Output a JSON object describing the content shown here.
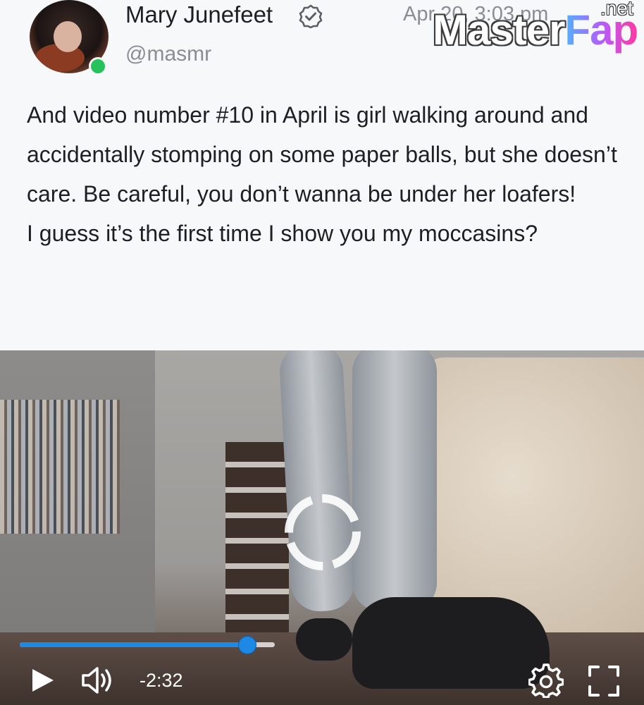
{
  "author": {
    "display_name": "Mary Junefeet",
    "handle": "@masmr",
    "verified": true,
    "online": true,
    "status_color": "#27c25b"
  },
  "post": {
    "timestamp": "Apr 20, 3:03 pm",
    "text_lines": [
      "And video number #10 in April is girl walking around and accidentally stomping on some paper balls, but she doesn’t care. Be careful, you don’t wanna be under her loafers!",
      "I guess it’s the first time I show you my moccasins?"
    ]
  },
  "watermark": {
    "main_left": "Master",
    "main_right": "Fap",
    "tld": ".net"
  },
  "video": {
    "state": "loading",
    "progress_fraction": 0.89,
    "time_remaining": "-2:32",
    "accent_color": "#1e88e5",
    "controls": {
      "play_icon": "play-icon",
      "volume_icon": "volume-icon",
      "settings_icon": "gear-icon",
      "fullscreen_icon": "fullscreen-icon"
    }
  }
}
